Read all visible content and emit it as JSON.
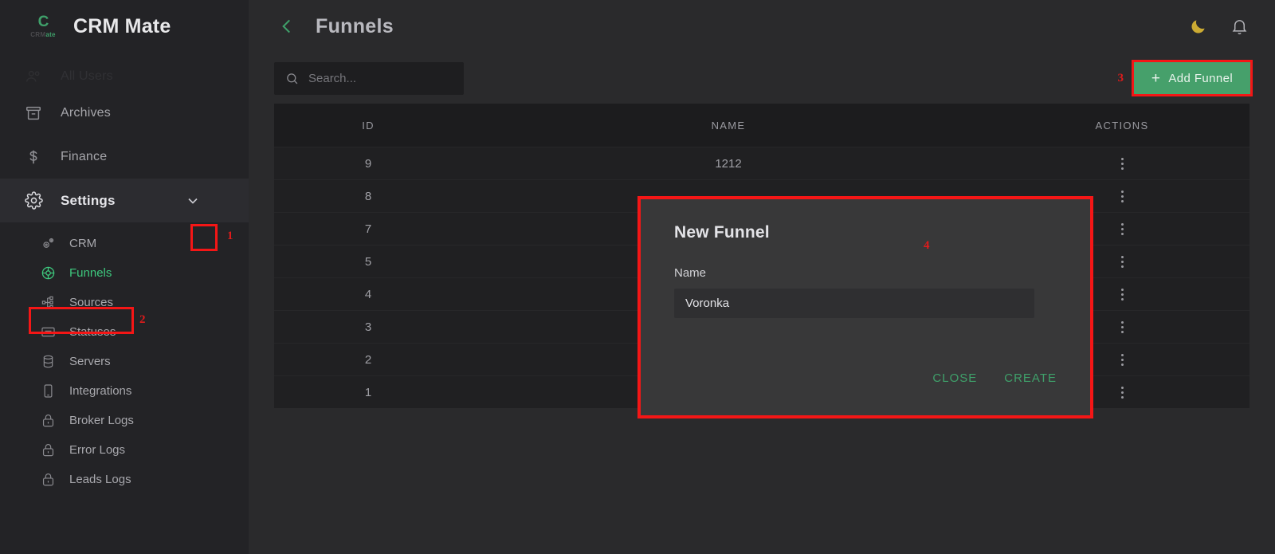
{
  "app": {
    "brand_name": "CRM Mate",
    "logo_mark": "C",
    "logo_sub_grey": "CRM",
    "logo_sub_green": "ate",
    "accent_green": "#3fa06a",
    "annotation_red": "#f41616",
    "sidebar_bg": "#232326",
    "main_bg": "#2a2a2c",
    "table_bg": "#202022",
    "modal_bg": "#383839"
  },
  "sidebar": {
    "scrolled_item": "All Users",
    "items": [
      {
        "label": "All Users",
        "icon": "users-icon",
        "state": "cut-off"
      },
      {
        "label": "Archives",
        "icon": "archive-icon",
        "state": "normal"
      },
      {
        "label": "Finance",
        "icon": "dollar-icon",
        "state": "normal"
      },
      {
        "label": "Settings",
        "icon": "gear-icon",
        "state": "expanded"
      }
    ],
    "settings_chevron": "chevron-down-icon",
    "sub_items": [
      {
        "label": "CRM",
        "icon": "gears-icon",
        "selected": false
      },
      {
        "label": "Funnels",
        "icon": "funnel-ring-icon",
        "selected": true
      },
      {
        "label": "Sources",
        "icon": "sitemap-icon",
        "selected": false
      },
      {
        "label": "Statuses",
        "icon": "card-icon",
        "selected": false
      },
      {
        "label": "Servers",
        "icon": "database-icon",
        "selected": false
      },
      {
        "label": "Integrations",
        "icon": "device-icon",
        "selected": false
      },
      {
        "label": "Broker Logs",
        "icon": "lock-icon",
        "selected": false
      },
      {
        "label": "Error Logs",
        "icon": "lock-icon",
        "selected": false
      },
      {
        "label": "Leads Logs",
        "icon": "lock-icon",
        "selected": false
      }
    ]
  },
  "header": {
    "back_icon": "chevron-left-icon",
    "title": "Funnels",
    "theme_toggle_icon": "moon-icon",
    "theme_toggle_color": "#ccab33",
    "notifications_icon": "bell-icon"
  },
  "toolbar": {
    "search_placeholder": "Search...",
    "search_value": "",
    "search_icon": "search-icon",
    "add_button_label": "Add Funnel",
    "add_button_plus": "+"
  },
  "table": {
    "columns": [
      "ID",
      "NAME",
      "ACTIONS"
    ],
    "action_icon": "three-dots-vertical-icon",
    "rows": [
      {
        "id": "9",
        "name": "1212"
      },
      {
        "id": "8",
        "name": ""
      },
      {
        "id": "7",
        "name": ""
      },
      {
        "id": "5",
        "name": ""
      },
      {
        "id": "4",
        "name": ""
      },
      {
        "id": "3",
        "name": ""
      },
      {
        "id": "2",
        "name": ""
      },
      {
        "id": "1",
        "name": ""
      }
    ]
  },
  "modal": {
    "title": "New Funnel",
    "field_label": "Name",
    "field_value": "Voronka",
    "field_placeholder": "",
    "close_label": "CLOSE",
    "create_label": "CREATE"
  },
  "annotations": {
    "step1": "1",
    "step2": "2",
    "step3": "3",
    "step4": "4"
  }
}
